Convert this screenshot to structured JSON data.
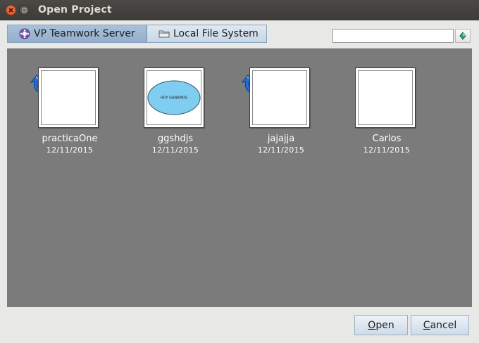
{
  "window": {
    "title": "Open Project",
    "buttons": {
      "close_icon": "close-icon",
      "maximize_icon": "maximize-icon"
    }
  },
  "tabs": [
    {
      "label": "VP Teamwork Server",
      "icon": "teamwork-server-icon",
      "active": true
    },
    {
      "label": "Local File System",
      "icon": "folder-icon",
      "active": false
    }
  ],
  "search": {
    "value": "",
    "placeholder": "",
    "button_icon": "search-diamond-icon"
  },
  "projects": [
    {
      "name": "practicaOne",
      "date": "12/11/2015",
      "has_update": true,
      "thumbnail": "blank"
    },
    {
      "name": "ggshdjs",
      "date": "12/11/2015",
      "has_update": false,
      "thumbnail": "ellipse",
      "thumbnail_text": "HOY GANAMOS"
    },
    {
      "name": "jajajja",
      "date": "12/11/2015",
      "has_update": true,
      "thumbnail": "blank"
    },
    {
      "name": "Carlos",
      "date": "12/11/2015",
      "has_update": false,
      "thumbnail": "blank"
    }
  ],
  "actions": {
    "open": {
      "mnemonic": "O",
      "rest": "pen"
    },
    "cancel": {
      "mnemonic": "C",
      "rest": "ancel"
    }
  },
  "colors": {
    "titlebar": "#3c3b37",
    "gallery_bg": "#7b7b7b",
    "tab_active": "#a0b9d5",
    "ellipse_fill": "#7fcdf0"
  }
}
